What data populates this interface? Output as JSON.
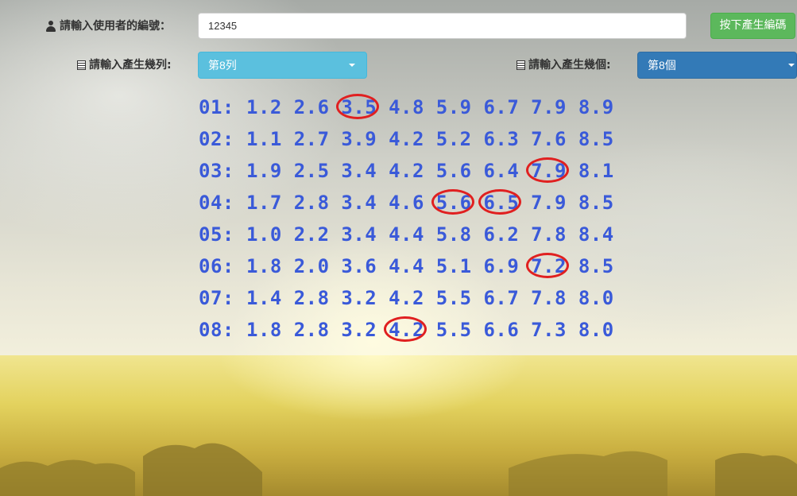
{
  "form": {
    "user_label": "請輸入使用者的編號：",
    "user_value": "12345",
    "generate_button": "按下產生編碼",
    "rows_label": "請輸入產生幾列:",
    "rows_selected": "第8列",
    "count_label": "請輸入產生幾個:",
    "count_selected": "第8個"
  },
  "results": [
    {
      "id": "01:",
      "values": [
        "1.2",
        "2.6",
        "3.5",
        "4.8",
        "5.9",
        "6.7",
        "7.9",
        "8.9"
      ],
      "circled": [
        2
      ]
    },
    {
      "id": "02:",
      "values": [
        "1.1",
        "2.7",
        "3.9",
        "4.2",
        "5.2",
        "6.3",
        "7.6",
        "8.5"
      ],
      "circled": []
    },
    {
      "id": "03:",
      "values": [
        "1.9",
        "2.5",
        "3.4",
        "4.2",
        "5.6",
        "6.4",
        "7.9",
        "8.1"
      ],
      "circled": [
        6
      ]
    },
    {
      "id": "04:",
      "values": [
        "1.7",
        "2.8",
        "3.4",
        "4.6",
        "5.6",
        "6.5",
        "7.9",
        "8.5"
      ],
      "circled": [
        4,
        5
      ]
    },
    {
      "id": "05:",
      "values": [
        "1.0",
        "2.2",
        "3.4",
        "4.4",
        "5.8",
        "6.2",
        "7.8",
        "8.4"
      ],
      "circled": []
    },
    {
      "id": "06:",
      "values": [
        "1.8",
        "2.0",
        "3.6",
        "4.4",
        "5.1",
        "6.9",
        "7.2",
        "8.5"
      ],
      "circled": [
        6
      ]
    },
    {
      "id": "07:",
      "values": [
        "1.4",
        "2.8",
        "3.2",
        "4.2",
        "5.5",
        "6.7",
        "7.8",
        "8.0"
      ],
      "circled": []
    },
    {
      "id": "08:",
      "values": [
        "1.8",
        "2.8",
        "3.2",
        "4.2",
        "5.5",
        "6.6",
        "7.3",
        "8.0"
      ],
      "circled": [
        3
      ]
    }
  ],
  "colors": {
    "number_text": "#3a5ad9",
    "circle_mark": "#e02020",
    "generate_button": "#5cb85c",
    "rows_select": "#5bc0de",
    "count_select": "#337ab7"
  },
  "icons": {
    "user": "user-icon",
    "list": "list-icon"
  }
}
